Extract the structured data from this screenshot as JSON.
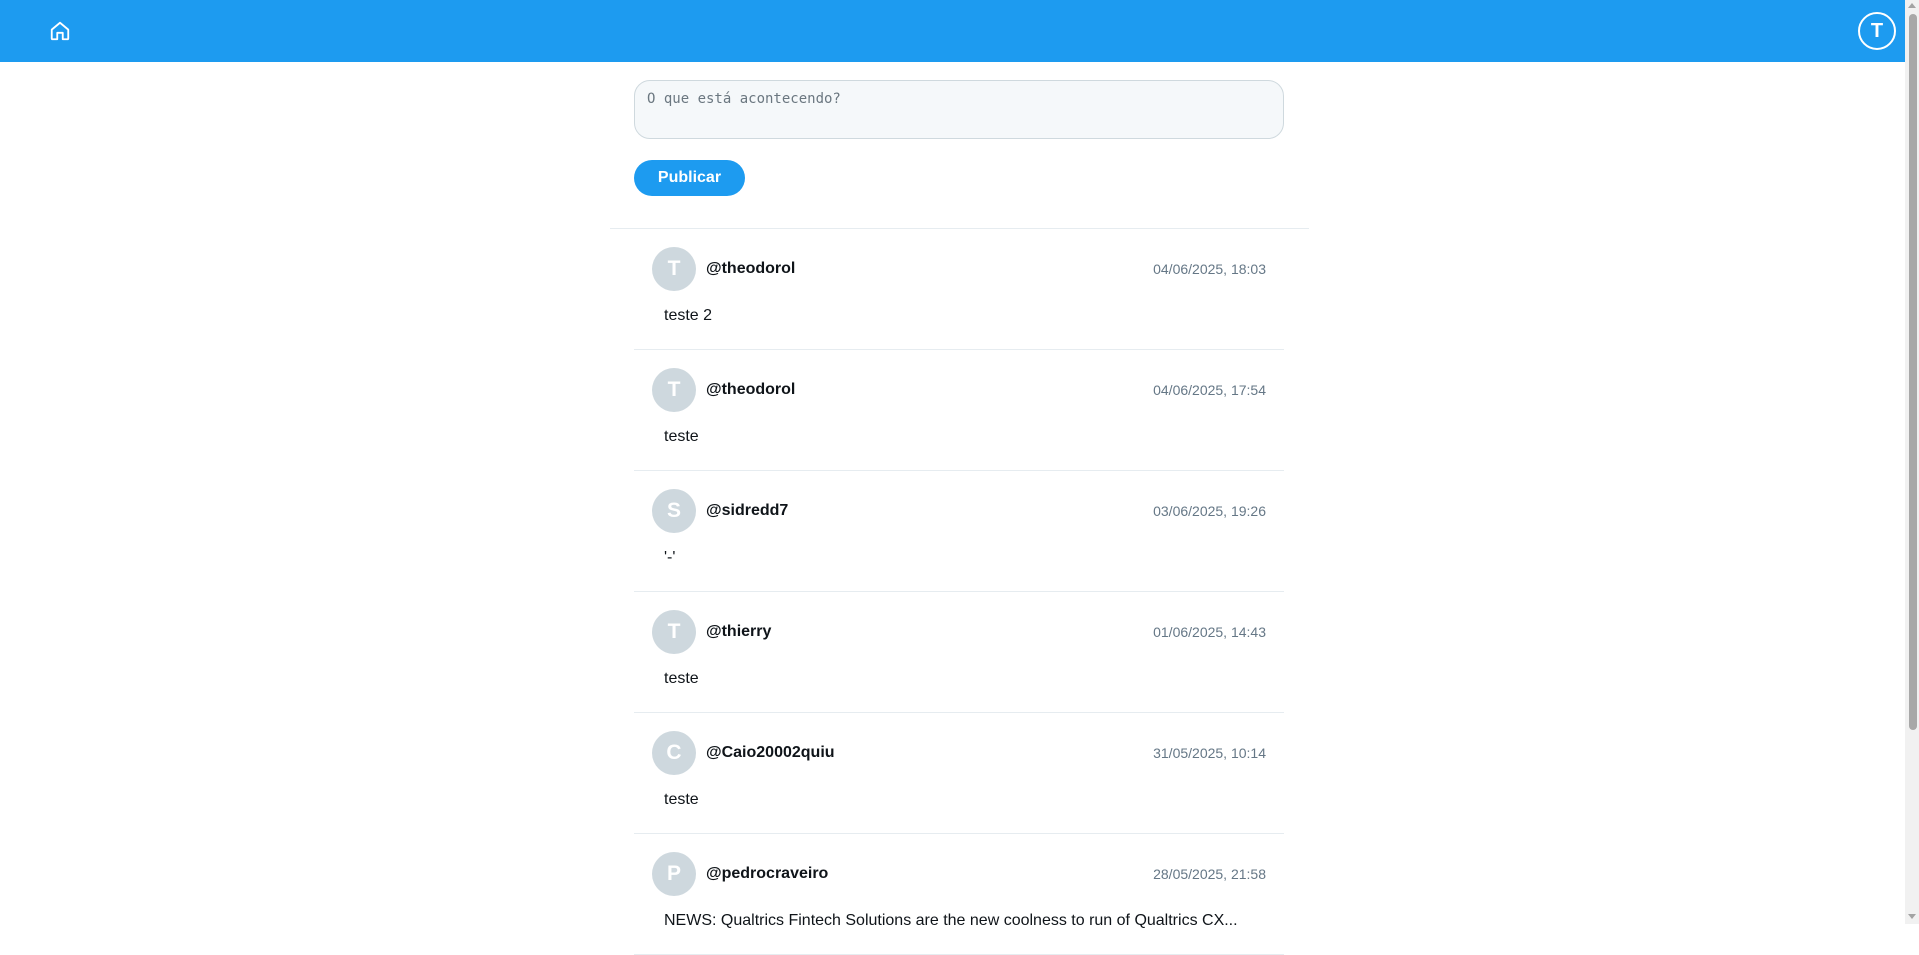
{
  "topbar": {
    "home_icon": "home-icon",
    "avatar_initial": "T",
    "colors": {
      "background": "#1d9bf0"
    }
  },
  "composer": {
    "placeholder": "O que está acontecendo?",
    "value": "",
    "publish_label": "Publicar"
  },
  "posts": [
    {
      "initial": "T",
      "username": "@theodorol",
      "timestamp": "04/06/2025, 18:03",
      "text": "teste 2"
    },
    {
      "initial": "T",
      "username": "@theodorol",
      "timestamp": "04/06/2025, 17:54",
      "text": "teste"
    },
    {
      "initial": "S",
      "username": "@sidredd7",
      "timestamp": "03/06/2025, 19:26",
      "text": "'-'"
    },
    {
      "initial": "T",
      "username": "@thierry",
      "timestamp": "01/06/2025, 14:43",
      "text": "teste"
    },
    {
      "initial": "C",
      "username": "@Caio20002quiu",
      "timestamp": "31/05/2025, 10:14",
      "text": "teste"
    },
    {
      "initial": "P",
      "username": "@pedrocraveiro",
      "timestamp": "28/05/2025, 21:58",
      "text": "NEWS: Qualtrics Fintech Solutions are the new coolness to run of Qualtrics CX..."
    }
  ]
}
